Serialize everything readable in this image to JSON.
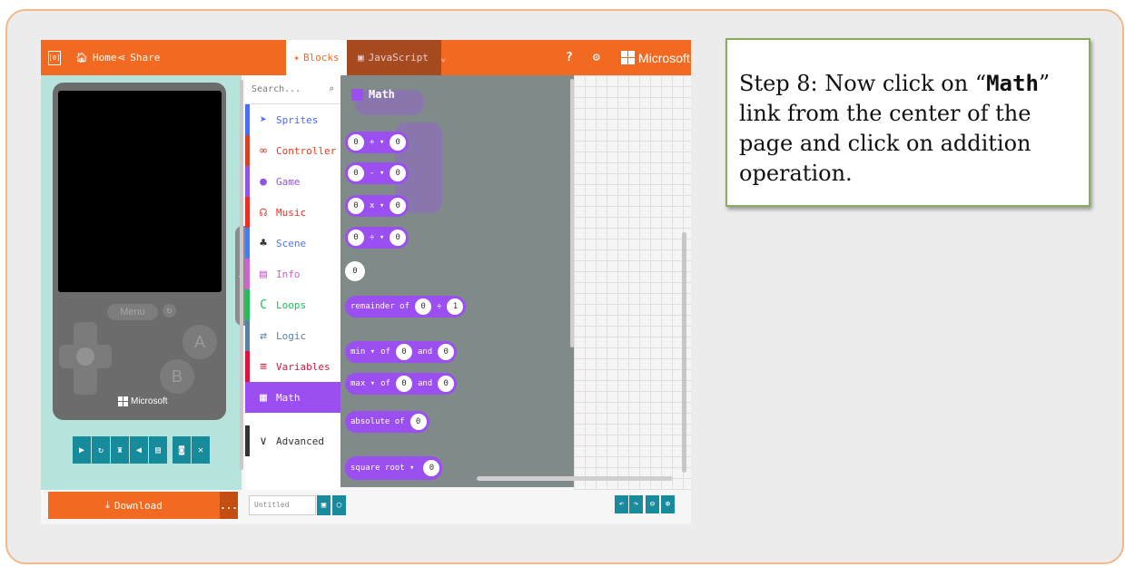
{
  "topbar": {
    "logo": "[0]",
    "home": "Home",
    "share": "Share",
    "tab_blocks": "Blocks",
    "tab_javascript": "JavaScript",
    "help_icon": "?",
    "settings_icon": "⚙",
    "brand": "Microsoft"
  },
  "simulator": {
    "menu": "Menu",
    "btn_a": "A",
    "btn_b": "B",
    "brand": "Microsoft",
    "toolbar_icons": [
      "play-icon",
      "restart-icon",
      "slowmo-icon",
      "sound-icon",
      "keyboard-icon",
      "screenshot-icon",
      "fullscreen-icon"
    ]
  },
  "download": {
    "label": "Download",
    "more": "..."
  },
  "categories": {
    "search_placeholder": "Search...",
    "items": [
      {
        "label": "Sprites",
        "icon": "paper-plane-icon",
        "color": "#4b6bfb"
      },
      {
        "label": "Controller",
        "icon": "gamepad-icon",
        "color": "#d54322"
      },
      {
        "label": "Game",
        "icon": "circle-icon",
        "color": "#8f56e6"
      },
      {
        "label": "Music",
        "icon": "headphones-icon",
        "color": "#e63022"
      },
      {
        "label": "Scene",
        "icon": "tree-icon",
        "color": "#4b7bec"
      },
      {
        "label": "Info",
        "icon": "id-card-icon",
        "color": "#cf63cf"
      },
      {
        "label": "Loops",
        "icon": "refresh-icon",
        "color": "#20bf55"
      },
      {
        "label": "Logic",
        "icon": "shuffle-icon",
        "color": "#5b80a5"
      },
      {
        "label": "Variables",
        "icon": "list-icon",
        "color": "#dc143c"
      },
      {
        "label": "Math",
        "icon": "calculator-icon",
        "color": "#9c4ff0"
      }
    ],
    "advanced": "Advanced"
  },
  "flyout": {
    "title": "Math",
    "blocks": {
      "add": {
        "a": "0",
        "op": "+ ▾",
        "b": "0"
      },
      "sub": {
        "a": "0",
        "op": "- ▾",
        "b": "0"
      },
      "mul": {
        "a": "0",
        "op": "x ▾",
        "b": "0"
      },
      "div": {
        "a": "0",
        "op": "÷ ▾",
        "b": "0"
      },
      "num": "0",
      "remainder": {
        "label": "remainder of",
        "a": "0",
        "sep": "÷",
        "b": "1"
      },
      "min": {
        "label": "min ▾",
        "of": "of",
        "a": "0",
        "and": "and",
        "b": "0"
      },
      "max": {
        "label": "max ▾",
        "of": "of",
        "a": "0",
        "and": "and",
        "b": "0"
      },
      "absolute": {
        "label": "absolute of",
        "a": "0"
      },
      "sqrt": {
        "label": "square root ▾",
        "a": "0"
      }
    }
  },
  "bottombar": {
    "project_name": "Untitled",
    "save_icon": "💾",
    "github_icon": "⎔"
  },
  "instruction": {
    "before": "Step 8: Now click on “",
    "bold": "Math",
    "after": "” link from the center of the page and click on addition operation."
  }
}
